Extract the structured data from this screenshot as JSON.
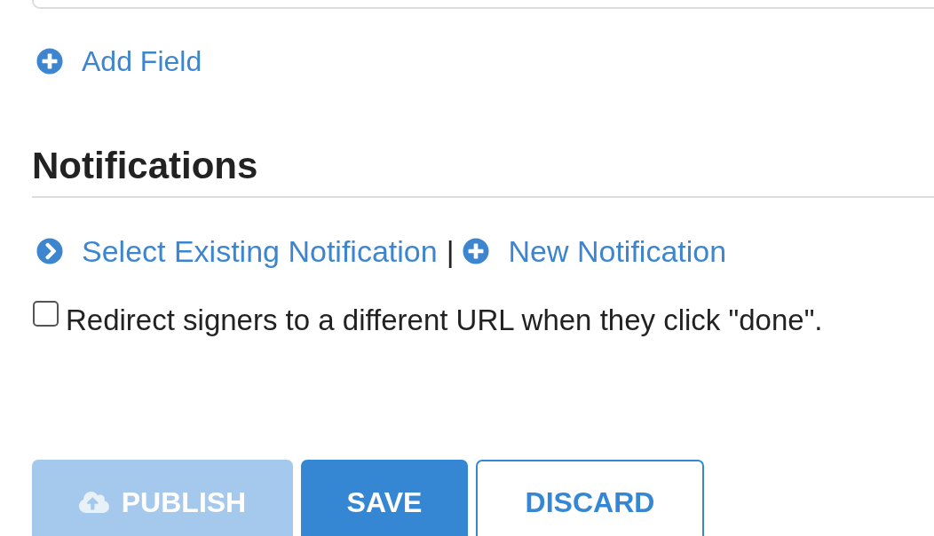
{
  "add_field": {
    "label": "Add Field"
  },
  "notifications": {
    "heading": "Notifications",
    "links": [
      {
        "kind": "select",
        "label": "Select Existing Notification"
      },
      {
        "kind": "new",
        "label": "New Notification"
      }
    ],
    "separator": "|",
    "redirect": {
      "label": "Redirect signers to a different URL when they click \"done\".",
      "checked": false
    }
  },
  "buttons": [
    {
      "kind": "publish",
      "label": "PUBLISH",
      "disabled": true
    },
    {
      "kind": "save",
      "label": "SAVE",
      "disabled": false
    },
    {
      "kind": "discard",
      "label": "DISCARD",
      "disabled": false
    }
  ]
}
